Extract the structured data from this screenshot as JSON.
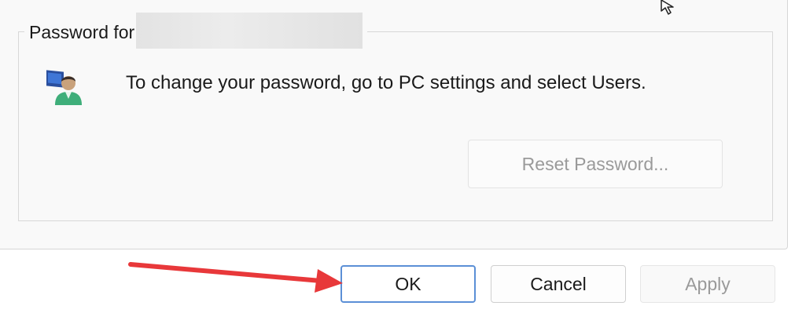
{
  "groupbox": {
    "title": "Password for"
  },
  "message": {
    "text": "To change your password, go to PC settings and select Users."
  },
  "buttons": {
    "reset_password": "Reset Password...",
    "ok": "OK",
    "cancel": "Cancel",
    "apply": "Apply"
  },
  "icons": {
    "user": "user-account-icon",
    "annotation": "red-arrow-icon",
    "cursor": "mouse-pointer-icon"
  },
  "colors": {
    "focus_border": "#5b8fd6",
    "arrow": "#e8383a",
    "disabled_text": "#9a9a9a"
  }
}
